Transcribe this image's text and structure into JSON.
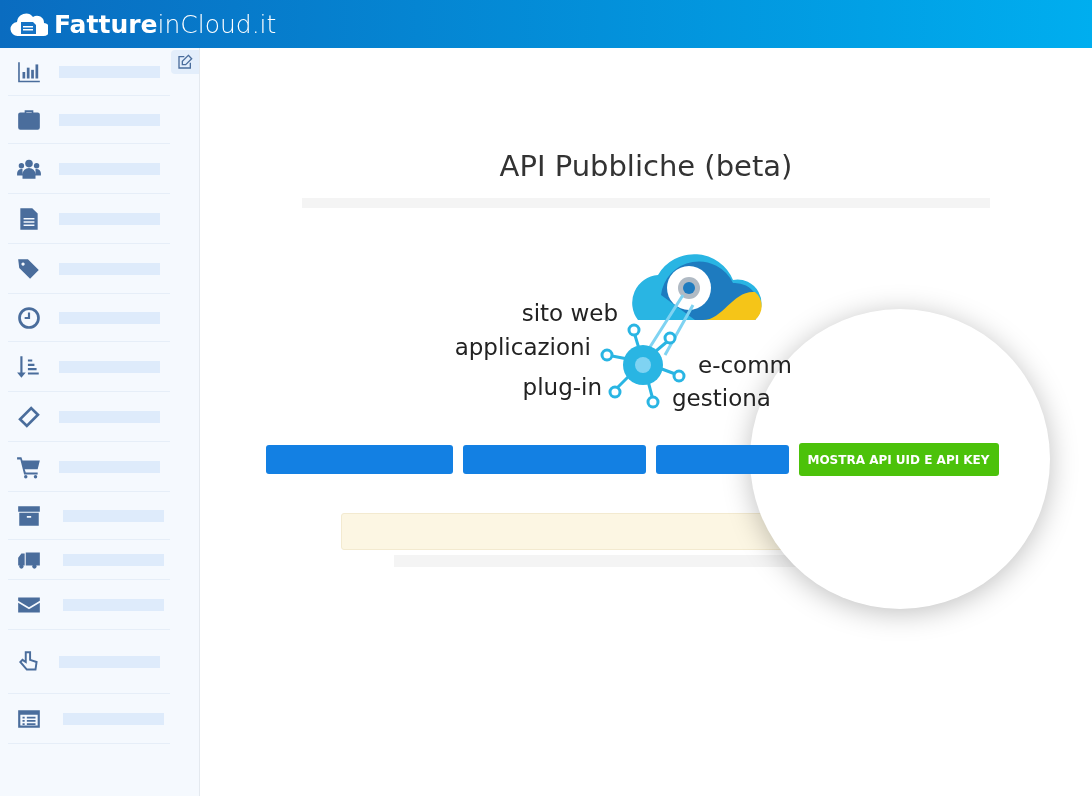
{
  "brand": {
    "bold": "Fatture",
    "light": "inCloud.it"
  },
  "page": {
    "title": "API Pubbliche (beta)"
  },
  "diagram": {
    "labels": [
      "sito web",
      "applicazioni",
      "plug-in",
      "e-comm",
      "gestiona"
    ]
  },
  "actions": {
    "primary_button": "MOSTRA API UID E API KEY"
  }
}
